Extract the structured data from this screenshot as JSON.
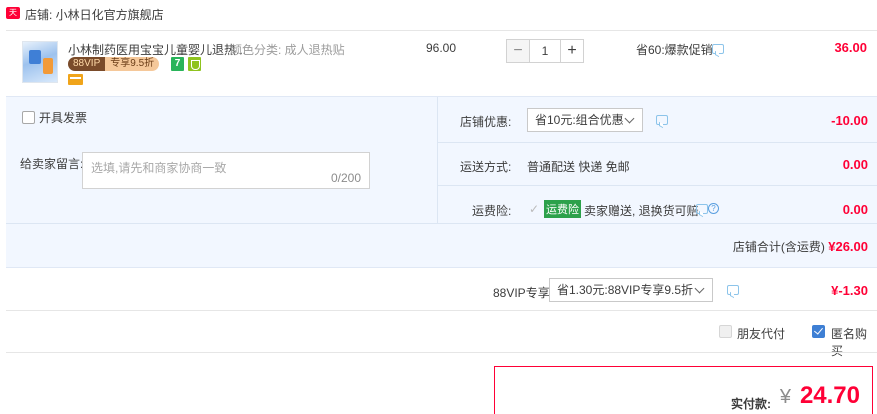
{
  "shop": {
    "tag": "天猫",
    "label": "店铺: 小林日化官方旗舰店"
  },
  "item": {
    "title": "小林制药医用宝宝儿童婴儿退热...",
    "sku": "颜色分类: 成人退热贴",
    "vip_tag_left": "88VIP",
    "vip_tag_right": "专享9.5折",
    "badge_7": "7",
    "unit_price": "96.00",
    "qty_minus": "−",
    "qty_value": "1",
    "qty_plus": "+",
    "promo": "省60:爆款促销",
    "total": "36.00"
  },
  "panel": {
    "invoice_label": "开具发票",
    "message_label": "给卖家留言:",
    "message_placeholder": "选填,请先和商家协商一致",
    "message_count": "0/200",
    "shop_discount_label": "店铺优惠:",
    "shop_discount_value": "省10元:组合优惠",
    "shop_discount_amount": "-10.00",
    "shipping_label": "运送方式:",
    "shipping_value": "普通配送 快递 免邮",
    "shipping_amount": "0.00",
    "insurance_label": "运费险:",
    "insurance_check": "✓",
    "insurance_tag": "运费险",
    "insurance_text": "卖家赠送, 退换货可赔",
    "insurance_amount": "0.00",
    "shop_total_label": "店铺合计(含运费)",
    "shop_total_amount": "¥26.00"
  },
  "vip": {
    "label": "88VIP专享",
    "select_value": "省1.30元:88VIP专享9.5折",
    "amount": "¥-1.30"
  },
  "options": {
    "friend_pay_label": "朋友代付",
    "anonymous_label": "匿名购买",
    "friend_pay_checked": false,
    "anonymous_checked": true
  },
  "payment": {
    "label": "实付款:",
    "currency": "¥",
    "amount": "24.70"
  },
  "colors": {
    "accent": "#ff0036",
    "panel_bg": "#f2f7ff",
    "checkbox_on": "#3e7fd4",
    "insurance_green": "#2ca14b"
  },
  "icons": [
    "tmall-icon",
    "chat-icon",
    "chevron-down-icon",
    "help-icon",
    "card-icon",
    "shield-icon"
  ]
}
